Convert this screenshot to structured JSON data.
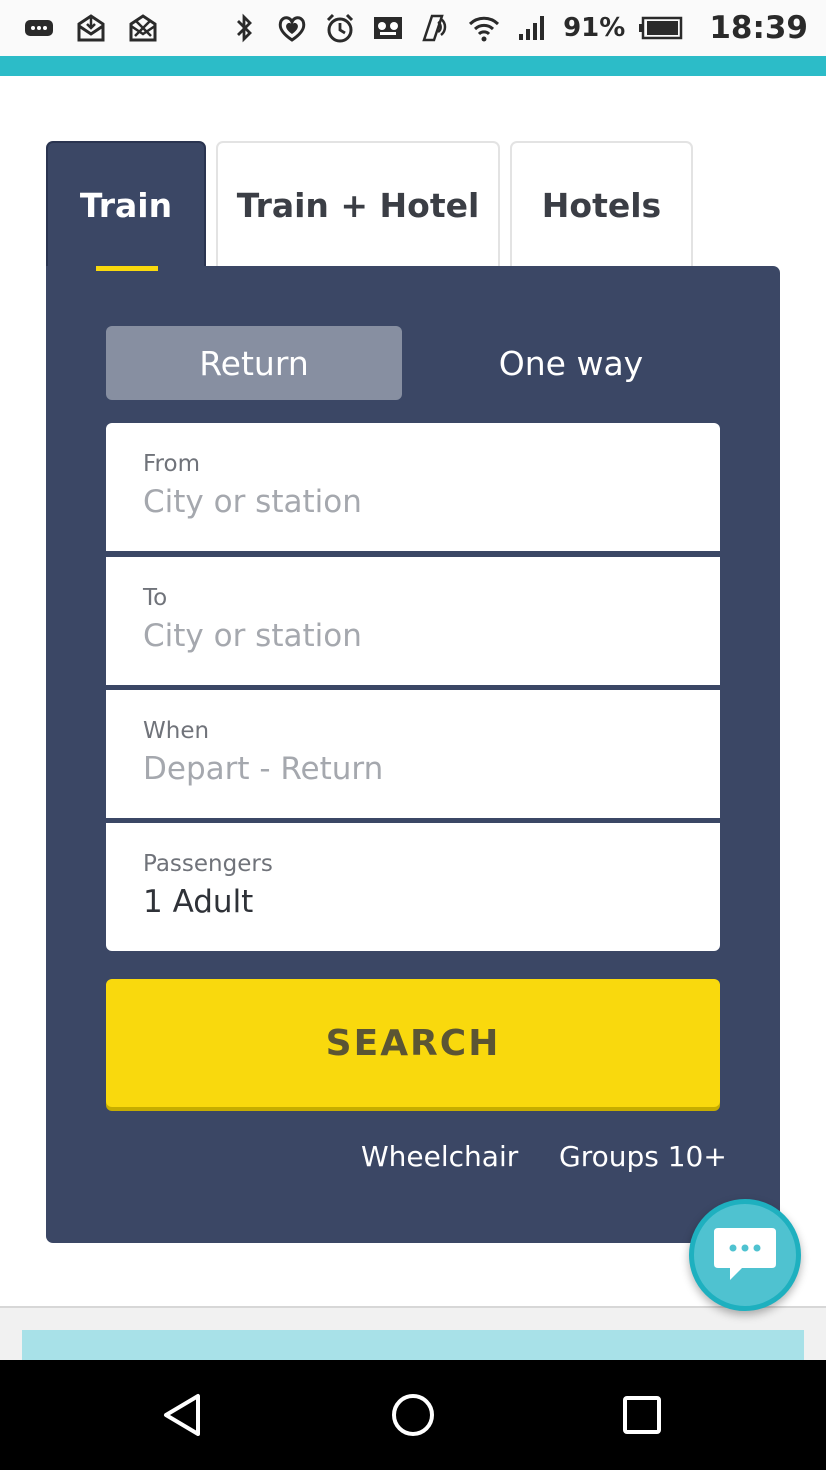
{
  "status_bar": {
    "battery_percent": "91%",
    "time": "18:39",
    "left_icons": [
      "more-icon",
      "mail-download-icon",
      "mail-icon"
    ],
    "right_icons": [
      "bluetooth-icon",
      "heart-shield-icon",
      "alarm-icon",
      "voicemail-icon",
      "nfc-icon",
      "wifi-icon",
      "signal-icon",
      "battery-icon"
    ]
  },
  "tabs": [
    {
      "label": "Train",
      "active": true
    },
    {
      "label": "Train + Hotel",
      "active": false
    },
    {
      "label": "Hotels",
      "active": false
    }
  ],
  "trip_type": {
    "return_label": "Return",
    "one_way_label": "One way",
    "selected": "Return"
  },
  "form": {
    "from": {
      "label": "From",
      "placeholder": "City or station"
    },
    "to": {
      "label": "To",
      "placeholder": "City or station"
    },
    "when": {
      "label": "When",
      "placeholder": "Depart - Return"
    },
    "passengers": {
      "label": "Passengers",
      "value": "1 Adult"
    }
  },
  "search_label": "SEARCH",
  "links": {
    "wheelchair": "Wheelchair",
    "groups": "Groups 10+"
  },
  "colors": {
    "panel": "#3b4765",
    "accent_yellow": "#f9d90d",
    "teal": "#2cbcc8",
    "chat": "#4fc2d0"
  }
}
